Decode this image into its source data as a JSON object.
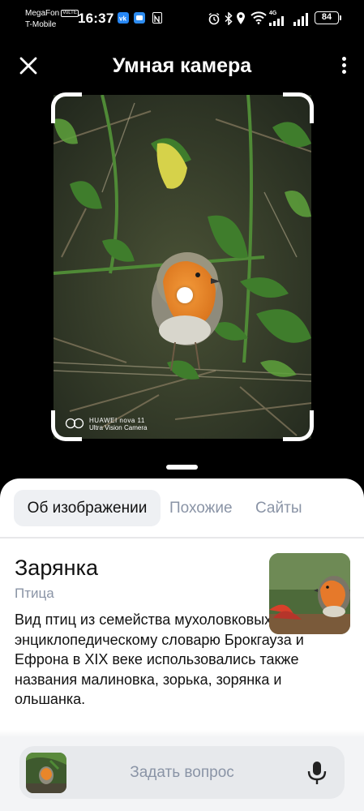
{
  "status_bar": {
    "carrier1": "MegaFon",
    "volte": "VoLTE",
    "carrier2": "T-Mobile",
    "time": "16:37",
    "network": "4G",
    "battery": "84"
  },
  "header": {
    "title": "Умная камера"
  },
  "photo": {
    "watermark_line1": "HUAWEI nova 11",
    "watermark_line2": "Ultra Vision Camera"
  },
  "sheet": {
    "tabs": [
      {
        "label": "Об изображении",
        "active": true
      },
      {
        "label": "Похожие",
        "active": false
      },
      {
        "label": "Сайты",
        "active": false
      }
    ],
    "result": {
      "title": "Зарянка",
      "subtitle": "Птица",
      "description": "Вид птиц из семейства мухоловковых. Согласно энциклопедическому словарю Брокгауза и Ефрона в XIX веке использовались также названия малиновка, зорька, зорянка и ольшанка."
    },
    "ask": {
      "placeholder": "Задать вопрос"
    }
  },
  "colors": {
    "accent_gray": "#8a94a6",
    "tab_bg": "#eef0f3",
    "robin_orange": "#e8862a"
  }
}
